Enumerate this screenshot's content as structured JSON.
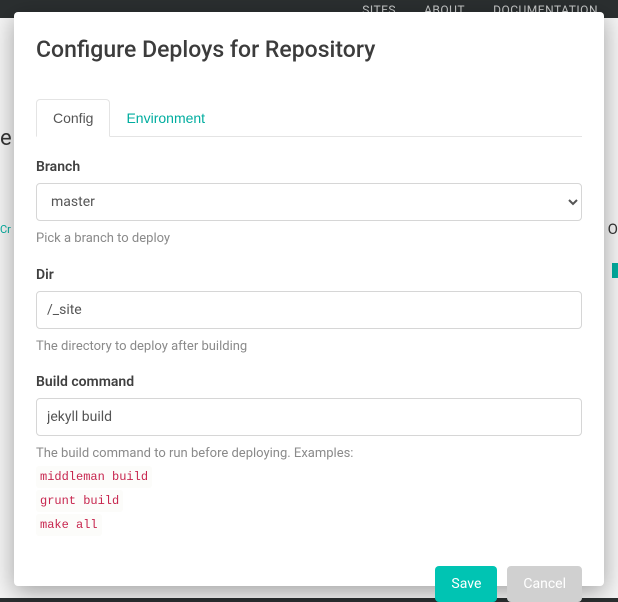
{
  "backgroundNav": {
    "sites": "SITES",
    "about": "ABOUT",
    "docs": "DOCUMENTATION"
  },
  "modal": {
    "title": "Configure Deploys for Repository",
    "tabs": {
      "config": "Config",
      "environment": "Environment"
    },
    "branch": {
      "label": "Branch",
      "value": "master",
      "help": "Pick a branch to deploy"
    },
    "dir": {
      "label": "Dir",
      "value": "/_site",
      "help": "The directory to deploy after building"
    },
    "build": {
      "label": "Build command",
      "value": "jekyll build",
      "helpPrefix": "The build command to run before deploying. Examples:",
      "examples": [
        "middleman build",
        "grunt build",
        "make all"
      ]
    },
    "buttons": {
      "save": "Save",
      "cancel": "Cancel"
    }
  }
}
